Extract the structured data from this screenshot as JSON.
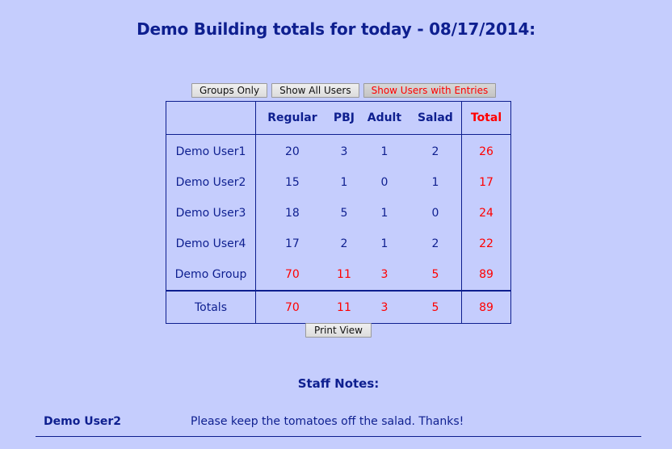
{
  "page": {
    "title": "Demo Building totals for today - 08/17/2014:"
  },
  "filters": {
    "buttons": [
      {
        "label": "Groups Only",
        "active": false
      },
      {
        "label": "Show All Users",
        "active": false
      },
      {
        "label": "Show Users with Entries",
        "active": true
      }
    ]
  },
  "table": {
    "columns": [
      "",
      "Regular",
      "PBJ",
      "Adult",
      "Salad",
      "Total"
    ],
    "rows": [
      {
        "name": "Demo User1",
        "values": [
          "20",
          "3",
          "1",
          "2"
        ],
        "total": "26"
      },
      {
        "name": "Demo User2",
        "values": [
          "15",
          "1",
          "0",
          "1"
        ],
        "total": "17"
      },
      {
        "name": "Demo User3",
        "values": [
          "18",
          "5",
          "1",
          "0"
        ],
        "total": "24"
      },
      {
        "name": "Demo User4",
        "values": [
          "17",
          "2",
          "1",
          "2"
        ],
        "total": "22"
      },
      {
        "name": "Demo Group",
        "values": [
          "70",
          "11",
          "3",
          "5"
        ],
        "total": "89"
      }
    ],
    "totals": {
      "label": "Totals",
      "values": [
        "70",
        "11",
        "3",
        "5"
      ],
      "total": "89"
    }
  },
  "actions": {
    "print_label": "Print View"
  },
  "notes": {
    "title": "Staff Notes:",
    "items": [
      {
        "user": "Demo User2",
        "text": "Please keep the tomatoes off the salad. Thanks!"
      }
    ]
  },
  "colors": {
    "background": "#c5cdfd",
    "text": "#0e1f8f",
    "accent": "#ff0000"
  }
}
